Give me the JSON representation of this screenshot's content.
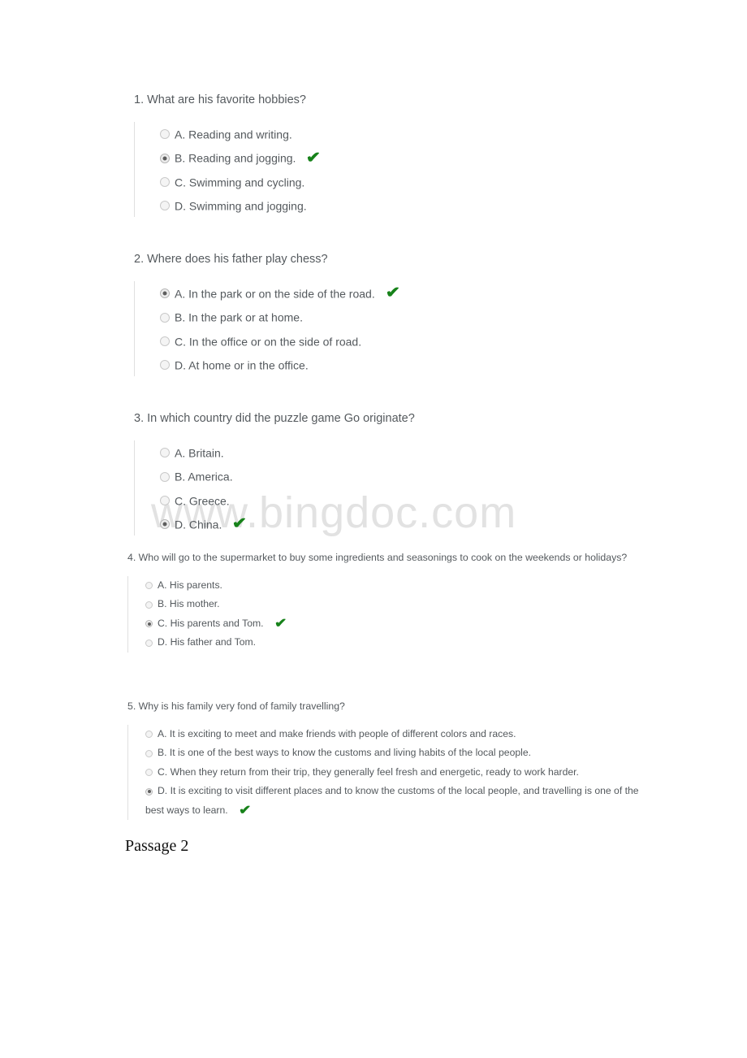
{
  "page": {
    "background_color": "#ffffff",
    "text_color": "#555a5e",
    "check_color": "#17821a",
    "watermark_color": "#e2e2e2"
  },
  "watermark": {
    "text": "www.bingdoc.com"
  },
  "footer": {
    "passage_label": "Passage 2"
  },
  "questions": [
    {
      "number": "1",
      "text": "1. What are his favorite hobbies?",
      "size": "lg",
      "options": [
        {
          "label": "A. Reading and writing.",
          "selected": false,
          "correct": false
        },
        {
          "label": "B. Reading and jogging.",
          "selected": true,
          "correct": true
        },
        {
          "label": "C. Swimming and cycling.",
          "selected": false,
          "correct": false
        },
        {
          "label": "D. Swimming and jogging.",
          "selected": false,
          "correct": false
        }
      ]
    },
    {
      "number": "2",
      "text": "2. Where does his father play chess?",
      "size": "lg",
      "options": [
        {
          "label": "A. In the park or on the side of the road.",
          "selected": true,
          "correct": true
        },
        {
          "label": "B. In the park or at home.",
          "selected": false,
          "correct": false
        },
        {
          "label": "C. In the office or on the side of road.",
          "selected": false,
          "correct": false
        },
        {
          "label": "D. At home or in the office.",
          "selected": false,
          "correct": false
        }
      ]
    },
    {
      "number": "3",
      "text": "3. In which country did the puzzle game Go originate?",
      "size": "lg",
      "options": [
        {
          "label": "A. Britain.",
          "selected": false,
          "correct": false
        },
        {
          "label": "B. America.",
          "selected": false,
          "correct": false
        },
        {
          "label": "C. Greece.",
          "selected": false,
          "correct": false
        },
        {
          "label": "D. China.",
          "selected": true,
          "correct": true
        }
      ]
    },
    {
      "number": "4",
      "text": "4. Who will go to the supermarket to buy some ingredients and seasonings to cook on the weekends or holidays?",
      "size": "sm",
      "options": [
        {
          "label": "A. His parents.",
          "selected": false,
          "correct": false
        },
        {
          "label": "B. His mother.",
          "selected": false,
          "correct": false
        },
        {
          "label": "C. His parents and Tom.",
          "selected": true,
          "correct": true
        },
        {
          "label": "D. His father and Tom.",
          "selected": false,
          "correct": false
        }
      ]
    },
    {
      "number": "5",
      "text": "5. Why is his family very fond of family travelling?",
      "size": "sm",
      "options": [
        {
          "label": "A. It is exciting to meet and make friends with people of different colors and races.",
          "selected": false,
          "correct": false
        },
        {
          "label": "B. It is one of the best ways to know the customs and living habits of the local people.",
          "selected": false,
          "correct": false
        },
        {
          "label": "C. When they return from their trip, they generally feel fresh and energetic, ready to work harder.",
          "selected": false,
          "correct": false
        },
        {
          "label": "D. It is exciting to visit different places and to know the customs of the local people, and travelling is one of the best ways to learn.",
          "selected": true,
          "correct": true,
          "wrap": true
        }
      ]
    }
  ],
  "icons": {
    "check": "✔"
  }
}
